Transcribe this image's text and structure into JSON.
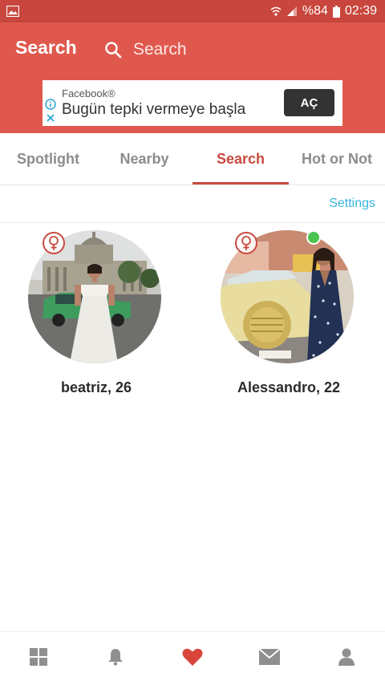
{
  "status_bar": {
    "battery_text": "%84",
    "time": "02:39"
  },
  "header": {
    "title": "Search",
    "search_placeholder": "Search"
  },
  "ad": {
    "source": "Facebook®",
    "text": "Bugün tepki vermeye başla",
    "cta": "AÇ"
  },
  "tabs": [
    {
      "label": "Spotlight",
      "active": false
    },
    {
      "label": "Nearby",
      "active": false
    },
    {
      "label": "Search",
      "active": true
    },
    {
      "label": "Hot or Not",
      "active": false
    }
  ],
  "settings_label": "Settings",
  "profiles": [
    {
      "name_age": "beatriz, 26",
      "gender_icon": "female-icon",
      "online": false
    },
    {
      "name_age": "Alessandro, 22",
      "gender_icon": "female-icon",
      "online": true
    }
  ],
  "bottom_nav": [
    {
      "icon": "grid-icon",
      "active": false
    },
    {
      "icon": "bell-icon",
      "active": false
    },
    {
      "icon": "heart-icon",
      "active": true
    },
    {
      "icon": "mail-icon",
      "active": false
    },
    {
      "icon": "person-icon",
      "active": false
    }
  ],
  "colors": {
    "status_bar": "#c8463d",
    "app_bar": "#e0584d",
    "accent": "#c84a3f",
    "link": "#37b6de",
    "online": "#4ac44e"
  }
}
